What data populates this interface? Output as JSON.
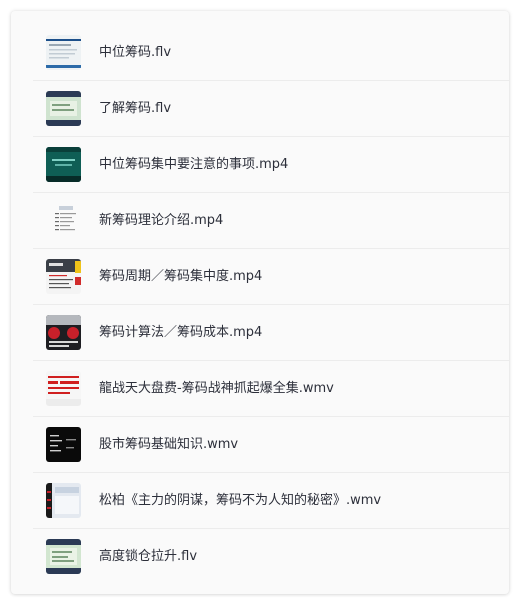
{
  "files": [
    {
      "name": "中位筹码.flv",
      "icon": "video-thumbnail-icon"
    },
    {
      "name": "了解筹码.flv",
      "icon": "video-thumbnail-icon"
    },
    {
      "name": "中位筹码集中要注意的事项.mp4",
      "icon": "video-thumbnail-icon"
    },
    {
      "name": "新筹码理论介绍.mp4",
      "icon": "video-thumbnail-icon"
    },
    {
      "name": "筹码周期／筹码集中度.mp4",
      "icon": "video-thumbnail-icon"
    },
    {
      "name": "筹码计算法／筹码成本.mp4",
      "icon": "video-thumbnail-icon"
    },
    {
      "name": "龍战天大盘费-筹码战神抓起爆全集.wmv",
      "icon": "video-thumbnail-icon"
    },
    {
      "name": "股市筹码基础知识.wmv",
      "icon": "video-thumbnail-icon"
    },
    {
      "name": "松柏《主力的阴谋，筹码不为人知的秘密》.wmv",
      "icon": "video-thumbnail-icon"
    },
    {
      "name": "高度锁仓拉升.flv",
      "icon": "video-thumbnail-icon"
    }
  ],
  "colors": {
    "panel_bg": "#fafafa",
    "text": "#2c2f3a",
    "divider": "#ececec"
  }
}
